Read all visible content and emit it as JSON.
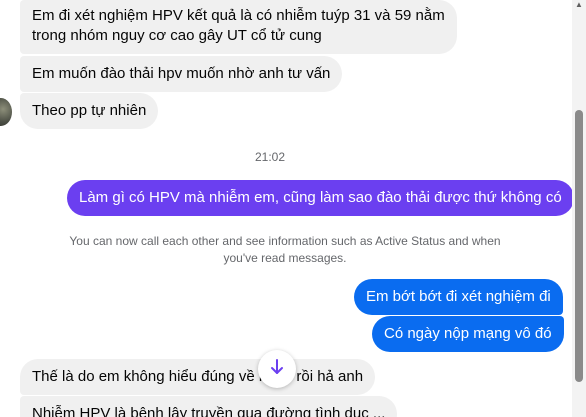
{
  "messages": {
    "m1_line1": "Em đi xét nghiệm HPV kết quả là có nhiễm tuýp 31 và 59 nằm",
    "m1_line2": "trong nhóm nguy cơ cao gây UT cổ tử cung",
    "m2": "Em muốn đào thải hpv muốn nhờ anh tư vấn",
    "m3": "Theo pp tự nhiên",
    "m4": "Làm gì có HPV mà nhiễm em, cũng làm sao đào thải được thứ không có",
    "m5": "Em bớt bớt đi xét nghiệm đi",
    "m6": "Có ngày nộp mạng vô đó",
    "m7": "Thế là do em không hiểu đúng về bệnh rồi hả anh",
    "m8_partial": "Nhiễm HPV là bệnh lây truyền qua đường tình dục ..."
  },
  "timestamp": "21:02",
  "notice_line1": "You can now call each other and see information such as Active Status and when",
  "notice_line2": "you've read messages.",
  "icons": {
    "scroll_down": "arrow-down-icon",
    "avatar": "contact-avatar"
  },
  "colors": {
    "incoming_bubble": "#f0f0f0",
    "outgoing_purple": "#6b3ff0",
    "outgoing_blue": "#0a6cf0",
    "meta_text": "#65676b"
  }
}
